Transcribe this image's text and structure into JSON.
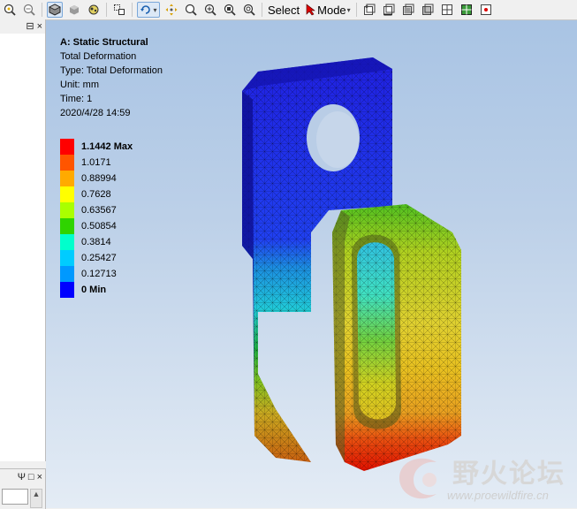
{
  "toolbar": {
    "select_label": "Select",
    "mode_label": "Mode",
    "dropdown_glyph": "▾"
  },
  "left_panel": {
    "top_controls": [
      "⊟",
      "×"
    ],
    "bottom_controls": [
      "Ψ",
      "□",
      "×"
    ]
  },
  "viewport": {
    "analysis_title": "A: Static Structural",
    "result_name": "Total Deformation",
    "type_line": "Type: Total Deformation",
    "unit_line": "Unit: mm",
    "time_line": "Time: 1",
    "date_line": "2020/4/28 14:59"
  },
  "legend": {
    "entries": [
      {
        "label": "1.1442 Max",
        "color": "#ff0000",
        "bold": true
      },
      {
        "label": "1.0171",
        "color": "#ff5500",
        "bold": false
      },
      {
        "label": "0.88994",
        "color": "#ffaa00",
        "bold": false
      },
      {
        "label": "0.7628",
        "color": "#ffff00",
        "bold": false
      },
      {
        "label": "0.63567",
        "color": "#aaff00",
        "bold": false
      },
      {
        "label": "0.50854",
        "color": "#2fd400",
        "bold": false
      },
      {
        "label": "0.3814",
        "color": "#00ffcc",
        "bold": false
      },
      {
        "label": "0.25427",
        "color": "#00ccff",
        "bold": false
      },
      {
        "label": "0.12713",
        "color": "#0099ff",
        "bold": false
      },
      {
        "label": "0 Min",
        "color": "#0000ff",
        "bold": true
      }
    ]
  },
  "watermark": {
    "text": "野火论坛",
    "url": "www.proewildfire.cn"
  }
}
